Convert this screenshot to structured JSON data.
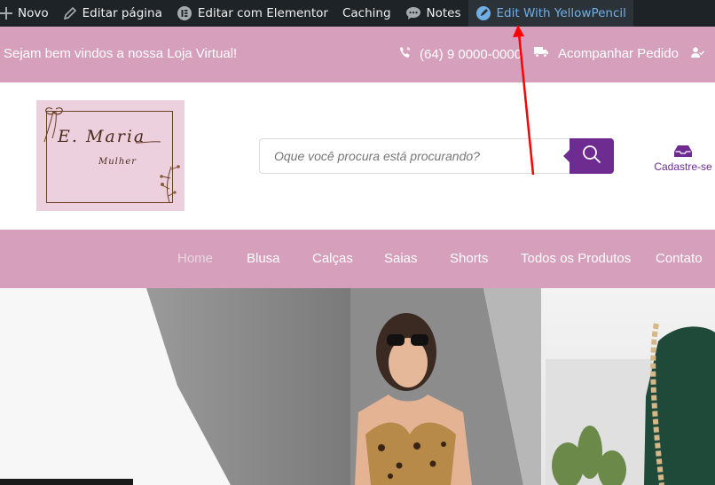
{
  "admin_bar": {
    "items": [
      {
        "label": "Novo",
        "icon": "plus-icon"
      },
      {
        "label": "Editar página",
        "icon": "pencil-icon"
      },
      {
        "label": "Editar com Elementor",
        "icon": "elementor-icon"
      },
      {
        "label": "Caching",
        "icon": ""
      },
      {
        "label": "Notes",
        "icon": "comment-icon"
      },
      {
        "label": "Edit With YellowPencil",
        "icon": "yellowpencil-icon"
      }
    ]
  },
  "top_bar": {
    "welcome": "Sejam bem vindos a nossa Loja Virtual!",
    "phone": "(64) 9 0000-0000",
    "track_order": "Acompanhar Pedido"
  },
  "header": {
    "logo_text": "E. Maria",
    "logo_subtext": "Mulher",
    "search_placeholder": "Oque você procura está procurando?",
    "account_label": "Cadastre-se"
  },
  "nav": {
    "items": [
      "Home",
      "Blusa",
      "Calças",
      "Saias",
      "Shorts",
      "Todos os Produtos",
      "Contato"
    ]
  },
  "colors": {
    "admin_bar": "#1d2327",
    "pink": "#d69fbb",
    "purple": "#6e2c91",
    "annotation": "#ff0000"
  }
}
